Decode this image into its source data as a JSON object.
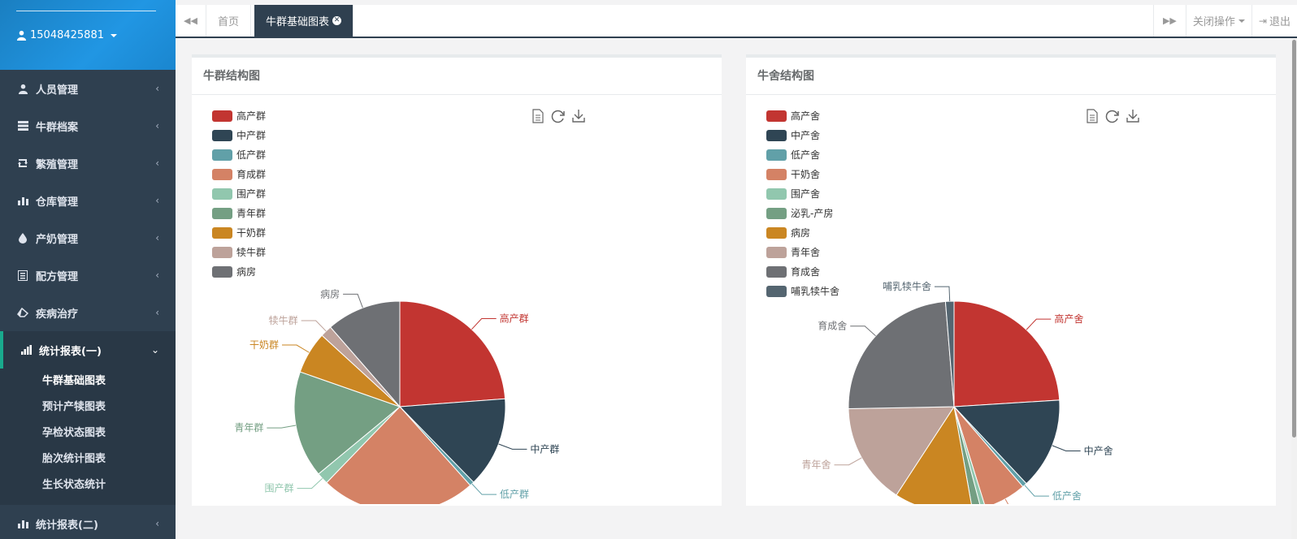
{
  "sidebar": {
    "username": "15048425881",
    "items": [
      {
        "label": "人员管理",
        "icon": "user-icon"
      },
      {
        "label": "牛群档案",
        "icon": "server-icon"
      },
      {
        "label": "繁殖管理",
        "icon": "retweet-icon"
      },
      {
        "label": "仓库管理",
        "icon": "bar-chart-icon"
      },
      {
        "label": "产奶管理",
        "icon": "drop-icon"
      },
      {
        "label": "配方管理",
        "icon": "list-icon"
      },
      {
        "label": "疾病治疗",
        "icon": "eraser-icon"
      }
    ],
    "active_group": {
      "label": "统计报表(一)",
      "children": [
        "牛群基础图表",
        "预计产犊图表",
        "孕检状态图表",
        "胎次统计图表",
        "生长状态统计"
      ]
    },
    "after_item": {
      "label": "统计报表(二)"
    }
  },
  "tabs": {
    "home": "首页",
    "active": "牛群基础图表",
    "close_ops": "关闭操作",
    "logout": "退出"
  },
  "colors": {
    "sidebar_bg": "#2f4050",
    "accent": "#1c84c6",
    "palette": [
      "#c23531",
      "#2f4554",
      "#61a0a8",
      "#d48265",
      "#91c7ae",
      "#749f83",
      "#ca8622",
      "#bda29a",
      "#6e7074",
      "#546570"
    ]
  },
  "chart_data": [
    {
      "type": "pie",
      "title": "牛群结构图",
      "legend_position": "top-left",
      "toolbox": [
        "data-view-icon",
        "restore-icon",
        "save-image-icon"
      ],
      "categories": [
        "高产群",
        "中产群",
        "低产群",
        "育成群",
        "围产群",
        "青年群",
        "干奶群",
        "犊牛群",
        "病房"
      ],
      "values": [
        24,
        14,
        0.7,
        24,
        1.8,
        16.5,
        6.5,
        1.8,
        11.5
      ]
    },
    {
      "type": "pie",
      "title": "牛舍结构图",
      "legend_position": "top-left",
      "toolbox": [
        "data-view-icon",
        "restore-icon",
        "save-image-icon"
      ],
      "categories": [
        "高产舍",
        "中产舍",
        "低产舍",
        "干奶舍",
        "围产舍",
        "泌乳-产房",
        "病房",
        "青年舍",
        "育成舍",
        "哺乳犊牛舍"
      ],
      "values": [
        24,
        14,
        0.7,
        6.5,
        0.7,
        1.3,
        12,
        15.5,
        24,
        1.3
      ]
    }
  ]
}
